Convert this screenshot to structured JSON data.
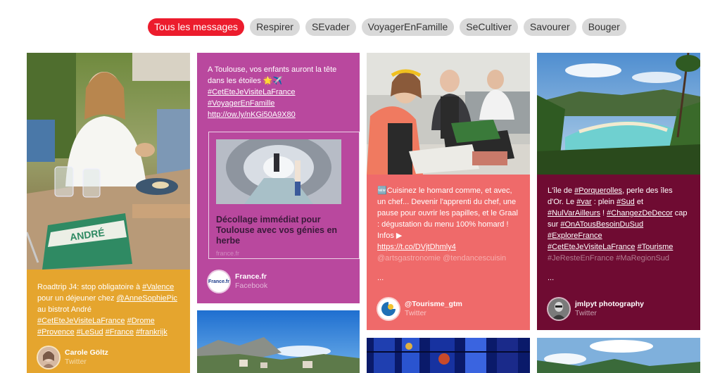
{
  "filters": [
    {
      "label": "Tous les messages",
      "active": true
    },
    {
      "label": "Respirer"
    },
    {
      "label": "SEvader"
    },
    {
      "label": "VoyagerEnFamille"
    },
    {
      "label": "SeCultiver"
    },
    {
      "label": "Savourer"
    },
    {
      "label": "Bouger"
    }
  ],
  "posts": {
    "carole": {
      "text_1": "Roadtrip J4: stop obligatoire à ",
      "tag_1": "#Valence",
      "text_2": " pour un déjeuner chez ",
      "tag_2": "@AnneSophiePic",
      "text_3": " au bistrot André ",
      "tag_3": "#CetEteJeVisiteLaFrance",
      "tag_4": "#Drome",
      "tag_5": "#Provence",
      "tag_6": "#LeSud",
      "tag_7": "#France",
      "tag_8": "#frankrijk",
      "author": "Carole Göltz",
      "source": "Twitter",
      "bg_color": "#e5a52e",
      "tablemat_text": "ANDRÉ"
    },
    "francefr": {
      "text_1": "A Toulouse, vos enfants auront la tête dans les étoiles ",
      "emoji": "🌟✈️",
      "tag_1": "#CetEteJeVisiteLaFrance",
      "tag_2": "#VoyagerEnFamille",
      "link": "http://ow.ly/nKGi50A9X80",
      "preview_title": "Décollage immédiat pour Toulouse avec vos génies en herbe",
      "preview_domain": "france.fr",
      "author": "France.fr",
      "source": "Facebook",
      "avatar_text": "France.fr",
      "bg_color": "#b9489e"
    },
    "tourisme": {
      "badge": "🆕",
      "text_1": "Cuisinez le homard comme, et avec, un chef... Devenir l'apprenti du chef, une pause pour ouvrir les papilles, et le Graal : dégustation du menu 100% homard ! Infos ▶",
      "link": "https://t.co/DVjtDhmly4",
      "faded": "@artsgastronomie @tendancescuisin",
      "ellipsis": "...",
      "author": "@Tourisme_gtm",
      "source": "Twitter",
      "bg_color": "#ef6a6a"
    },
    "jmlpyt": {
      "text_1": "L'île de ",
      "tag_1": "#Porquerolles",
      "text_2": ", perle des îles d'Or. Le ",
      "tag_2": "#var",
      "text_3": " : plein ",
      "tag_3": "#Sud",
      "text_4": " et ",
      "tag_4": "#NulVarAilleurs",
      "text_5": " ! ",
      "tag_5": "#ChangezDeDecor",
      "text_6": " cap sur ",
      "tag_6": "#OnATousBesoinDuSud",
      "tag_7": "#ExploreFrance",
      "tag_8": "#CetEteJeVisiteLaFrance",
      "tag_9": "#Tourisme",
      "faded": "#JeResteEnFrance #MaRegionSud",
      "ellipsis": "...",
      "author": "jmlpyt photography",
      "source": "Twitter",
      "bg_color": "#6f0b32"
    }
  }
}
